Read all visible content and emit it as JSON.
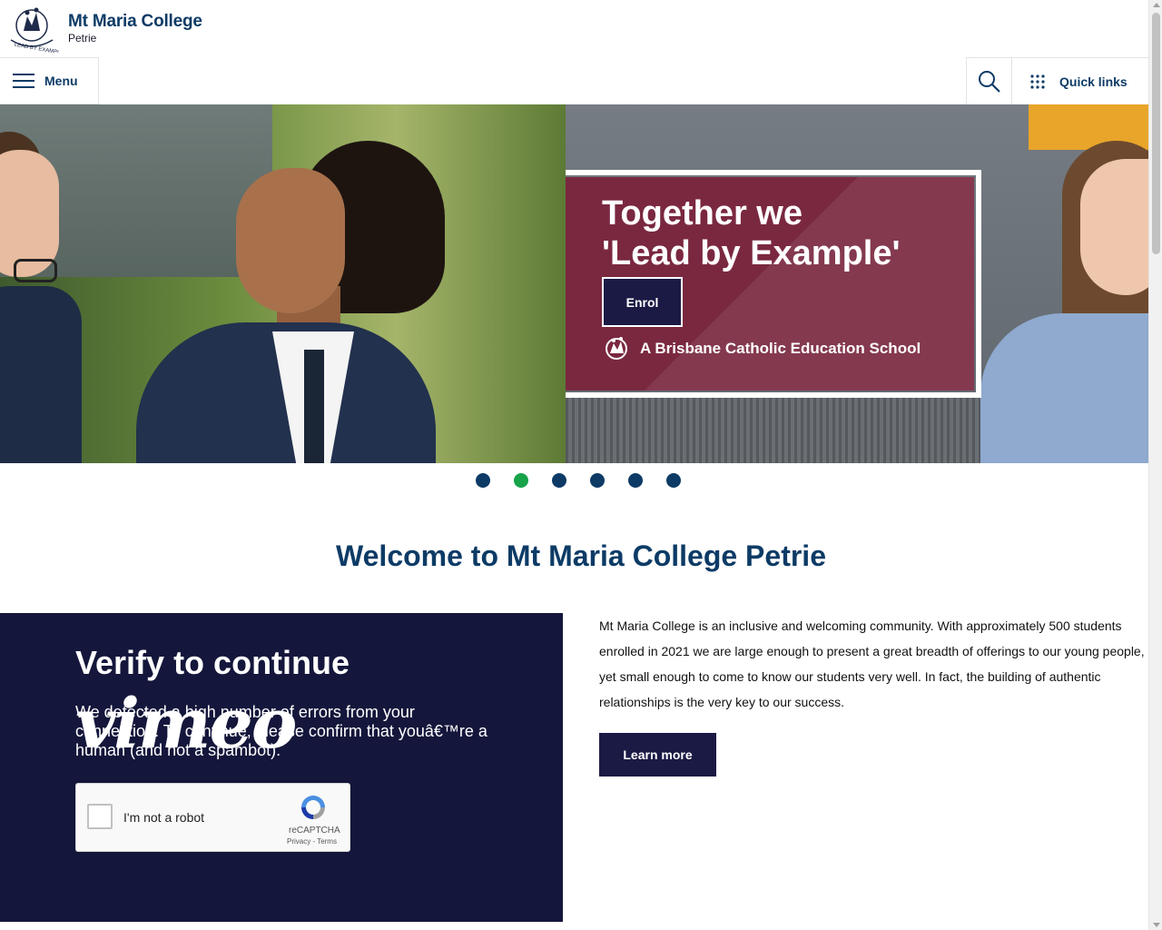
{
  "brand": {
    "title": "Mt Maria College",
    "subtitle": "Petrie"
  },
  "nav": {
    "menu_label": "Menu",
    "quick_links_label": "Quick links",
    "search_icon": "search-icon",
    "quick_links_icon": "grid-icon"
  },
  "hero": {
    "title_line1": "Together we",
    "title_line2": "'Lead by Example'",
    "enrol_label": "Enrol",
    "bce_text": "A Brisbane Catholic Education School",
    "card_color": "#7a2840"
  },
  "carousel": {
    "slide_count": 6,
    "active_index": 1
  },
  "welcome": {
    "heading": "Welcome to Mt Maria College Petrie"
  },
  "video": {
    "verify_title": "Verify to continue",
    "verify_text": "We detected a high number of errors from your connection. To continue, please confirm that youâ€™re a human (and not a spambot).",
    "vimeo_logo": "vimeo",
    "captcha_label": "I'm not a robot",
    "captcha_brand": "reCAPTCHA",
    "captcha_links": "Privacy - Terms"
  },
  "intro": {
    "paragraph": "Mt Maria College is an inclusive and welcoming community. With approximately 500 students enrolled in 2021 we are large enough to present a great breadth of offerings to our young people, yet small enough to come to know our students very well. In fact, the building of authentic relationships is the very key to our success.",
    "learn_more_label": "Learn more"
  },
  "colors": {
    "brand_navy": "#0d3b66",
    "button_dark": "#1b1a45",
    "active_dot": "#17a34a"
  }
}
